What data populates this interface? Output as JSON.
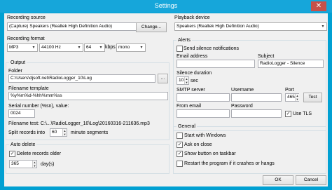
{
  "window": {
    "title": "Settings",
    "close_glyph": "✕"
  },
  "recording_source": {
    "label": "Recording source",
    "device": "(Capture) Speakers (Realtek High Definition Audio)",
    "change_button": "Change..."
  },
  "recording_format": {
    "label": "Recording format",
    "format": "MP3",
    "sample_rate": "44100 Hz",
    "bitrate": "64",
    "bitrate_unit": "kbps",
    "channels": "mono"
  },
  "output": {
    "group_label": "Output",
    "folder_label": "Folder",
    "folder_value": "C:\\Users\\djsoft.net\\RadioLogger_10\\Log",
    "browse_button": "...",
    "filename_template_label": "Filename template",
    "filename_template_value": "%y%m%d-%hh%mm%ss",
    "serial_label": "Serial number (%sn), value:",
    "serial_value": "0024",
    "filename_test": "Filename test: C:\\...\\RadioLogger_10\\Log\\20160316-211636.mp3",
    "split_label": "Split records into",
    "split_value": "60",
    "split_suffix": "minute segments"
  },
  "auto_delete": {
    "group_label": "Auto delete",
    "delete_older_label": "Delete records older",
    "delete_older_checked": true,
    "days_value": "365",
    "days_unit": "day(s)"
  },
  "playback_device": {
    "label": "Playback device",
    "device": "Speakers (Realtek High Definition Audio)"
  },
  "alerts": {
    "group_label": "Alerts",
    "send_silence_label": "Send silence notifications",
    "send_silence_checked": false,
    "email_label": "Email address",
    "email_value": "",
    "subject_label": "Subject",
    "subject_value": "RadioLogger - Silence",
    "silence_duration_label": "Silence duration",
    "silence_duration_value": "10",
    "silence_duration_unit": "sec",
    "smtp_server_label": "SMTP server",
    "smtp_server_value": "",
    "username_label": "Username",
    "username_value": "",
    "port_label": "Port",
    "port_value": "465",
    "test_button": "Test",
    "from_email_label": "From email",
    "from_email_value": "",
    "password_label": "Password",
    "password_value": "",
    "use_tls_label": "Use TLS",
    "use_tls_checked": true
  },
  "general": {
    "group_label": "General",
    "start_with_windows": "Start with Windows",
    "ask_on_close": "Ask on close",
    "show_button_taskbar": "Show button on taskbar",
    "restart_on_crash": "Restart the program if it crashes or hangs",
    "checks": {
      "start_with_windows": false,
      "ask_on_close": true,
      "show_button_taskbar": true,
      "restart_on_crash": false
    }
  },
  "footer": {
    "ok": "OK",
    "cancel": "Cancel"
  }
}
